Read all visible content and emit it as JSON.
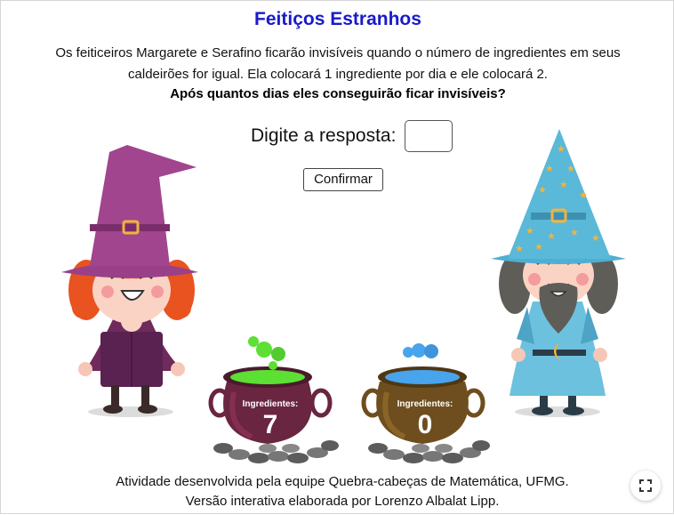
{
  "title": "Feitiços Estranhos",
  "description_line1": "Os feiticeiros Margarete e Serafino ficarão invisíveis quando o número de ingredientes em seus",
  "description_line2": "caldeirões for igual. Ela colocará 1 ingrediente por dia e ele colocará 2.",
  "question": "Após quantos dias eles conseguirão ficar invisíveis?",
  "prompt": "Digite a resposta:",
  "answer_value": "",
  "confirm_label": "Confirmar",
  "cauldron_left": {
    "label": "Ingredientes:",
    "count": "7",
    "liquid_color": "#5be033",
    "body_color": "#6a2540"
  },
  "cauldron_right": {
    "label": "Ingredientes:",
    "count": "0",
    "liquid_color": "#48a4ec",
    "body_color": "#6e4e1e"
  },
  "credits_line1": "Atividade desenvolvida pela equipe Quebra-cabeças de Matemática, UFMG.",
  "credits_line2": "Versão interativa elaborada por Lorenzo Albalat Lipp.",
  "colors": {
    "title": "#1a1acc",
    "witch_hat": "#a0458e",
    "wizard_hat": "#5ab8d8"
  },
  "icons": {
    "fullscreen": "fullscreen-icon"
  }
}
